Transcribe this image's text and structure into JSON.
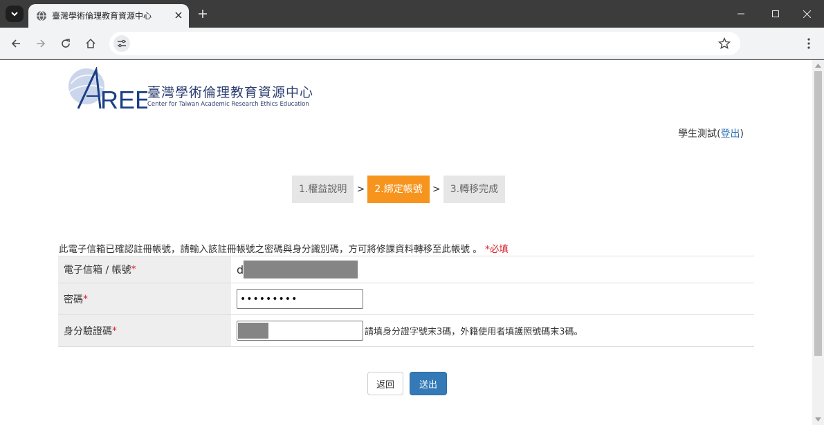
{
  "browser": {
    "tab_title": "臺灣學術倫理教育資源中心",
    "url": ""
  },
  "header": {
    "logo_text": "AREE",
    "logo_title": "臺灣學術倫理教育資源中心",
    "logo_subtitle": "Center for Taiwan Academic Research Ethics Education",
    "user_name": "學生測試",
    "logout_open": "(",
    "logout_label": "登出",
    "logout_close": ")"
  },
  "steps": [
    {
      "label": "1.權益說明",
      "active": false
    },
    {
      "label": "2.綁定帳號",
      "active": true
    },
    {
      "label": "3.轉移完成",
      "active": false
    }
  ],
  "step_separator": ">",
  "form": {
    "instruction": "此電子信箱已確認註冊帳號，請輸入該註冊帳號之密碼與身分識別碼，方可將修課資料轉移至此帳號 。",
    "required_note": "*必填",
    "email_label": "電子信箱 / 帳號",
    "email_value": "d",
    "password_label": "密碼",
    "password_value": "•••••••••",
    "idcode_label": "身分驗證碼",
    "idcode_hint": "請填身分證字號末3碼，外籍使用者填護照號碼末3碼。",
    "required_mark": "*"
  },
  "buttons": {
    "back": "返回",
    "submit": "送出"
  },
  "colors": {
    "active_step": "#f7941d",
    "submit_button": "#337ab7",
    "required": "#d9232d"
  }
}
